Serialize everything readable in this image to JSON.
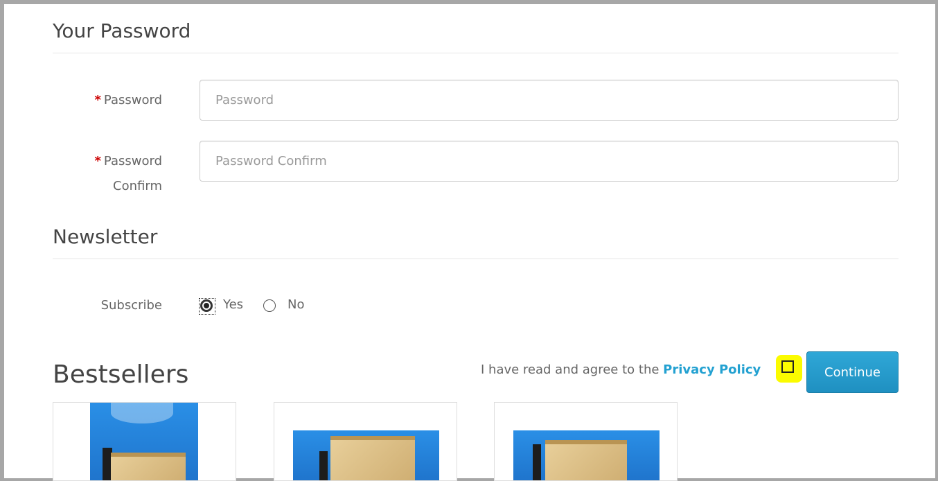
{
  "password_section": {
    "title": "Your Password",
    "password": {
      "required_mark": "*",
      "label": "Password",
      "placeholder": "Password"
    },
    "confirm": {
      "required_mark": "*",
      "label_line1": "Password",
      "label_line2": "Confirm",
      "placeholder": "Password Confirm"
    }
  },
  "newsletter_section": {
    "title": "Newsletter",
    "subscribe_label": "Subscribe",
    "options": [
      {
        "label": "Yes",
        "selected": true
      },
      {
        "label": "No",
        "selected": false
      }
    ]
  },
  "agreement": {
    "text": "I have read and agree to the",
    "link_text": "Privacy Policy",
    "checked": false,
    "continue_label": "Continue"
  },
  "bestsellers": {
    "title": "Bestsellers",
    "products": [
      {
        "icon": "product-box-image"
      },
      {
        "icon": "product-box-image"
      },
      {
        "icon": "product-box-image"
      }
    ]
  },
  "colors": {
    "link": "#23a1d1",
    "button": "#1f90c1",
    "required": "#cc0000",
    "highlight": "#fbfb00"
  }
}
